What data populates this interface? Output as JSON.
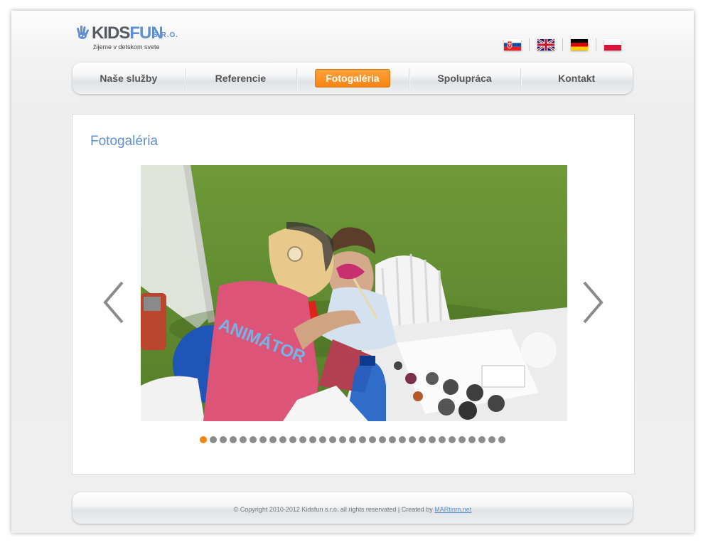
{
  "logo": {
    "word_kids": "KIDS",
    "word_fun": "FUN",
    "suffix": "S.R.O.",
    "tagline": "žijeme v detskom svete"
  },
  "languages": [
    {
      "code": "sk",
      "name": "slovak-flag"
    },
    {
      "code": "en",
      "name": "english-flag"
    },
    {
      "code": "de",
      "name": "german-flag"
    },
    {
      "code": "pl",
      "name": "polish-flag"
    }
  ],
  "nav": {
    "items": [
      {
        "label": "Naše služby"
      },
      {
        "label": "Referencie"
      },
      {
        "label": "Fotogaléria",
        "active": true
      },
      {
        "label": "Spolupráca"
      },
      {
        "label": "Kontakt"
      }
    ]
  },
  "gallery": {
    "title": "Fotogaléria",
    "shirt_text": "ANIMÁTOR",
    "slide_count": 31,
    "active_slide": 1,
    "icons": {
      "prev": "chevron-left-icon",
      "next": "chevron-right-icon"
    }
  },
  "footer": {
    "text": "© Copyright 2010-2012 Kidsfun s.r.o. all rights reservated | Created by ",
    "link": "MARtinm.net"
  },
  "colors": {
    "accent": "#f58412",
    "brand_blue": "#5e8fd0",
    "dot": "#8c8c8c"
  }
}
